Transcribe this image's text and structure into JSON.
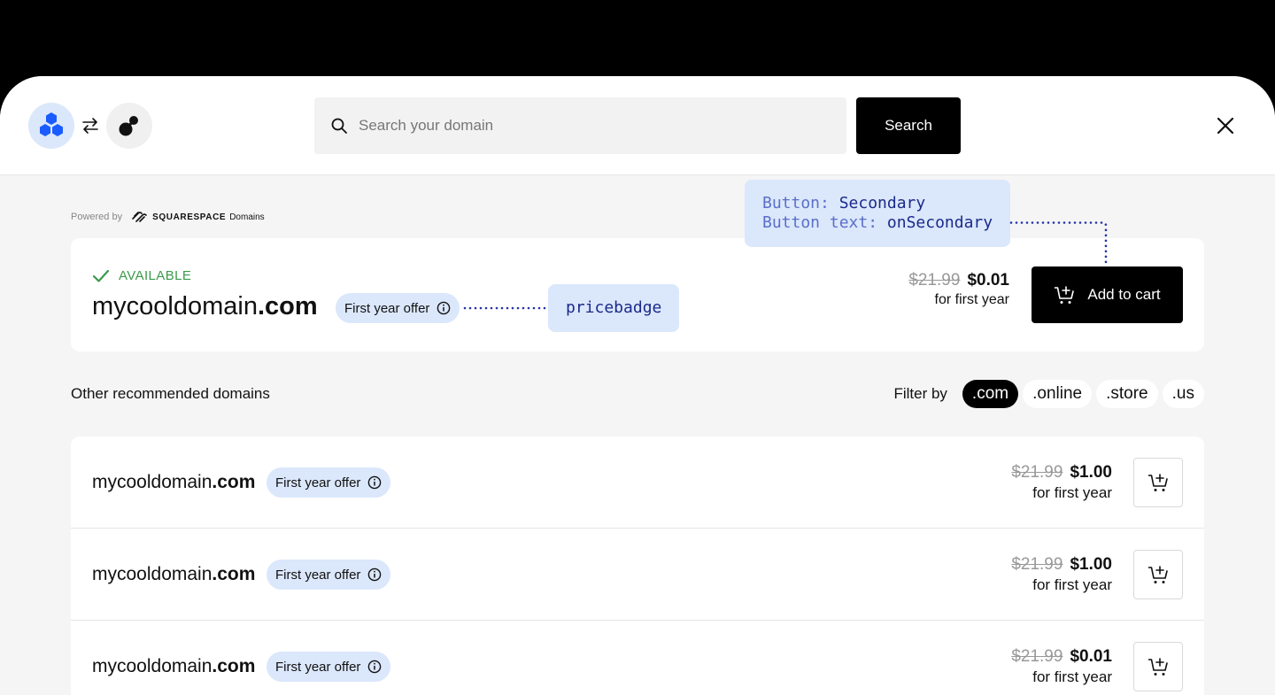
{
  "header": {
    "search_placeholder": "Search your domain",
    "search_label": "Search"
  },
  "powered_by": {
    "label": "Powered by",
    "brand": "SQUARESPACE",
    "brand_suffix": "Domains"
  },
  "hero": {
    "status": "AVAILABLE",
    "domain_name": "mycooldomain",
    "domain_tld": ".com",
    "badge": "First year offer",
    "price_old": "$21.99",
    "price_new": "$0.01",
    "price_sub": "for first year",
    "cart_label": "Add to cart"
  },
  "annotations": {
    "button_key": "Button:",
    "button_val": "Secondary",
    "text_key": "Button text:",
    "text_val": "onSecondary",
    "badge_label": "pricebadge"
  },
  "recommended": {
    "title": "Other recommended domains",
    "filter_label": "Filter by",
    "filters": [
      ".com",
      ".online",
      ".store",
      ".us"
    ],
    "active_filter": ".com",
    "rows": [
      {
        "name": "mycooldomain",
        "tld": ".com",
        "badge": "First year offer",
        "price_old": "$21.99",
        "price_new": "$1.00",
        "price_sub": "for first year"
      },
      {
        "name": "mycooldomain",
        "tld": ".com",
        "badge": "First year offer",
        "price_old": "$21.99",
        "price_new": "$1.00",
        "price_sub": "for first year"
      },
      {
        "name": "mycooldomain",
        "tld": ".com",
        "badge": "First year offer",
        "price_old": "$21.99",
        "price_new": "$0.01",
        "price_sub": "for first year"
      }
    ]
  },
  "colors": {
    "accent_blue": "#1a5cff",
    "badge_bg": "#dbe7fb",
    "available_green": "#3a9a4c",
    "annotation_text": "#1a2a8a"
  },
  "icons": [
    "hexagon-logo-icon",
    "swap-icon",
    "bubble-logo-icon",
    "search-icon",
    "close-icon",
    "check-icon",
    "info-icon",
    "cart-plus-icon",
    "squarespace-logo-icon"
  ]
}
